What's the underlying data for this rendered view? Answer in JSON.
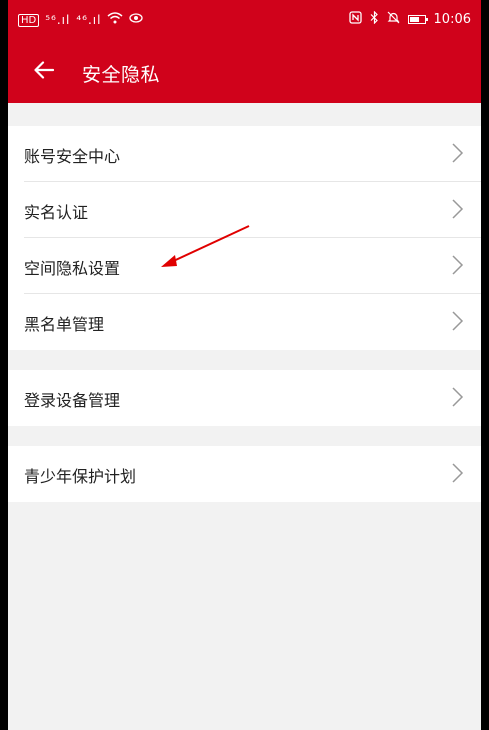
{
  "status_bar": {
    "left_text": "HD",
    "signal_1": "⁵⁶.ıl",
    "signal_2": "⁴⁶.ıl",
    "time": "10:06",
    "battery_percent": 60
  },
  "app_bar": {
    "back_icon": "arrow-left-icon",
    "title": "安全隐私"
  },
  "sections": [
    {
      "items": [
        {
          "label": "账号安全中心"
        },
        {
          "label": "实名认证"
        },
        {
          "label": "空间隐私设置"
        },
        {
          "label": "黑名单管理"
        }
      ]
    },
    {
      "items": [
        {
          "label": "登录设备管理"
        }
      ]
    },
    {
      "items": [
        {
          "label": "青少年保护计划"
        }
      ]
    }
  ],
  "colors": {
    "brand_red": "#d0021b",
    "annotation_arrow": "#e00000"
  }
}
